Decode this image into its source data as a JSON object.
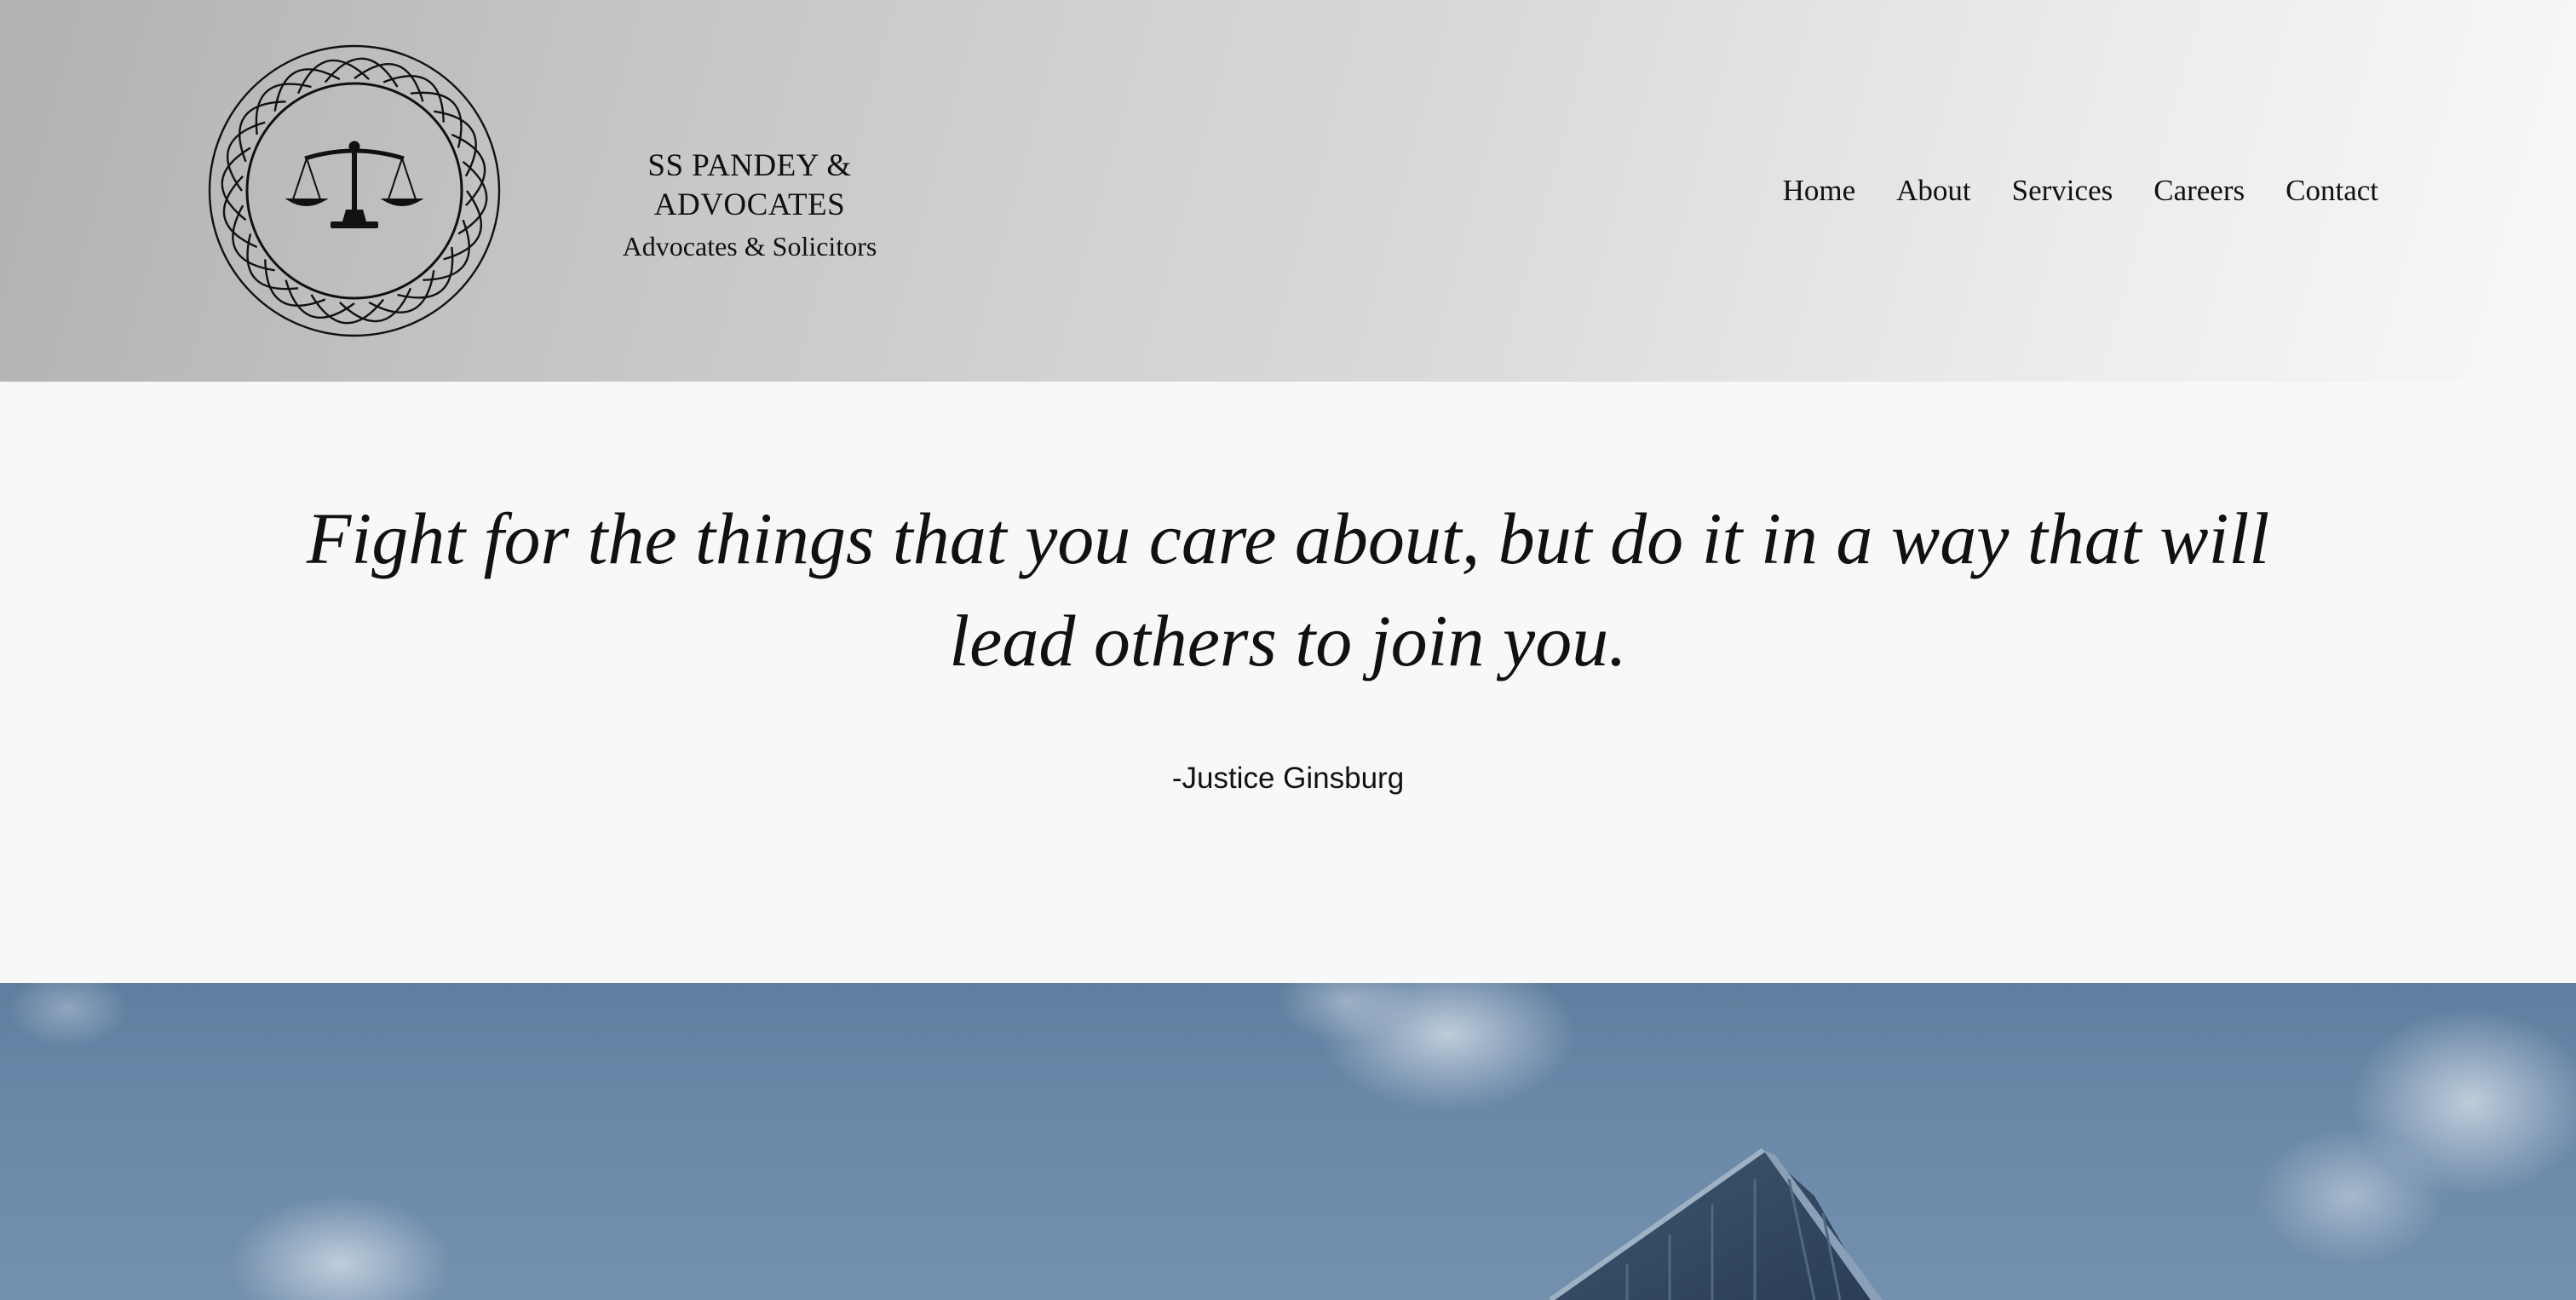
{
  "header": {
    "brand_name": "SS PANDEY & ADVOCATES",
    "tagline": "Advocates & Solicitors",
    "logo_icon": "scales-of-justice-icon"
  },
  "nav": {
    "items": [
      {
        "label": "Home"
      },
      {
        "label": "About"
      },
      {
        "label": "Services"
      },
      {
        "label": "Careers"
      },
      {
        "label": "Contact"
      }
    ]
  },
  "quote": {
    "text": "Fight for the things that you care about, but do it in a way that will lead others to join you.",
    "author": "-Justice Ginsburg"
  },
  "hero": {
    "image": "glass-building-against-blue-sky"
  },
  "colors": {
    "text": "#111111",
    "page_background": "#f8f8f8",
    "sky": "#6a88a8"
  }
}
